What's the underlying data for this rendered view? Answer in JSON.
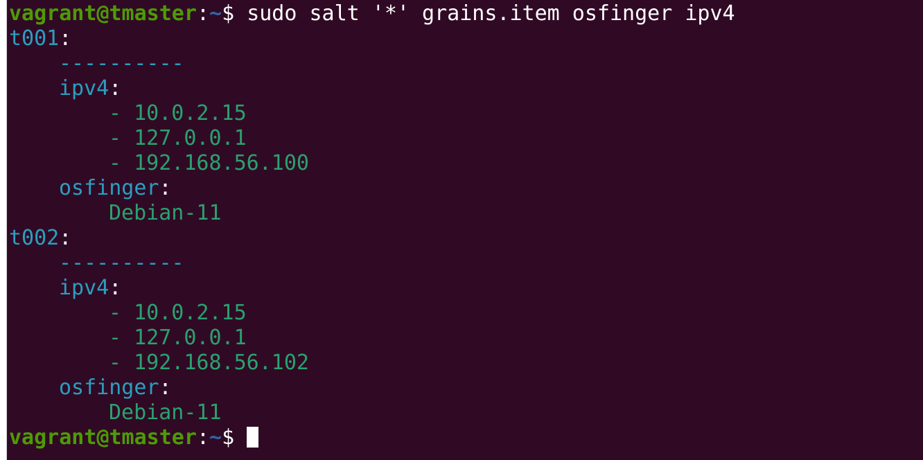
{
  "prompt": {
    "user_host": "vagrant@tmaster",
    "colon": ":",
    "cwd": "~",
    "symbol": "$ "
  },
  "command": "sudo salt '*' grains.item osfinger ipv4",
  "minions": [
    {
      "id": "t001",
      "separator": "----------",
      "ipv4_key": "ipv4",
      "ipv4": [
        "- 10.0.2.15",
        "- 127.0.0.1",
        "- 192.168.56.100"
      ],
      "osfinger_key": "osfinger",
      "osfinger": "Debian-11"
    },
    {
      "id": "t002",
      "separator": "----------",
      "ipv4_key": "ipv4",
      "ipv4": [
        "- 10.0.2.15",
        "- 127.0.0.1",
        "- 192.168.56.102"
      ],
      "osfinger_key": "osfinger",
      "osfinger": "Debian-11"
    }
  ],
  "colors": {
    "background": "#300a24",
    "prompt_user": "#4e9a06",
    "prompt_path": "#3465a4",
    "yaml_key": "#2a9fc0",
    "yaml_value": "#2aa16f"
  }
}
